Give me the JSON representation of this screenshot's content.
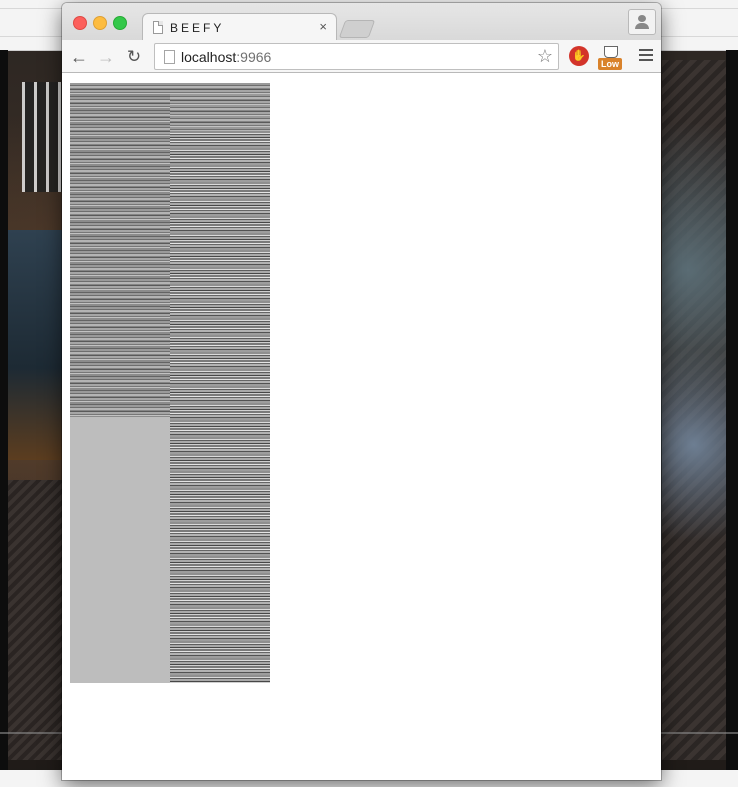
{
  "browser": {
    "tab": {
      "title": "BEEFY",
      "close_label": "×"
    },
    "toolbar": {
      "back_icon": "←",
      "forward_icon": "→",
      "reload_icon": "↻",
      "url_host": "localhost",
      "url_port": ":9966",
      "bookmark_icon": "☆",
      "extension_stop_glyph": "✋",
      "extension_low_badge": "Low"
    }
  },
  "colors": {
    "close": "#fc605c",
    "minimize": "#fdbc40",
    "maximize": "#34c84a",
    "left_block_gray": "#bdbdbd"
  },
  "icons": [
    "page-icon",
    "bookmark-star-icon",
    "profile-icon",
    "menu-icon",
    "stop-hand-icon",
    "coffee-cup-icon"
  ]
}
